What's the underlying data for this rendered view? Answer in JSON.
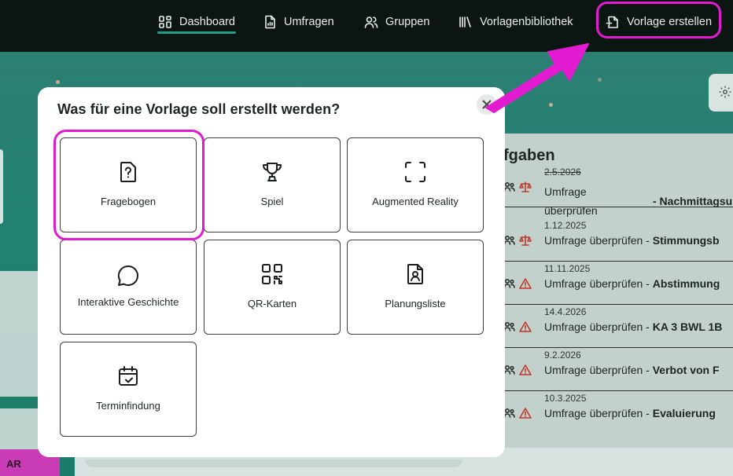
{
  "nav": {
    "items": [
      {
        "label": "Dashboard",
        "icon": "dashboard-icon",
        "active": true
      },
      {
        "label": "Umfragen",
        "icon": "survey-icon"
      },
      {
        "label": "Gruppen",
        "icon": "groups-icon"
      },
      {
        "label": "Vorlagenbibliothek",
        "icon": "library-icon"
      },
      {
        "label": "Vorlage erstellen",
        "icon": "file-plus-icon"
      }
    ],
    "accent": "#1f9e8a",
    "highlight_color": "#e21bd1"
  },
  "background": {
    "tasks_title": "fgaben",
    "ar_tag": "AR",
    "tasks": [
      {
        "date": "2.5.2026",
        "text": "Umfrage überprüfen",
        "bold": "- Nachmittagsu"
      },
      {
        "date": "1.12.2025",
        "text": "Umfrage überprüfen - ",
        "bold": "Stimmungsb"
      },
      {
        "date": "11.11.2025",
        "text": "Umfrage überprüfen - ",
        "bold": "Abstimmung"
      },
      {
        "date": "14.4.2026",
        "text": "Umfrage überprüfen - ",
        "bold": "KA 3 BWL 1B"
      },
      {
        "date": "9.2.2026",
        "text": "Umfrage überprüfen - ",
        "bold": "Verbot von F"
      },
      {
        "date": "10.3.2025",
        "text": "Umfrage überprüfen - ",
        "bold": "Evaluierung"
      }
    ]
  },
  "modal": {
    "title": "Was für eine Vorlage soll erstellt werden?",
    "tiles": [
      {
        "label": "Fragebogen",
        "icon": "question-file-icon",
        "highlighted": true
      },
      {
        "label": "Spiel",
        "icon": "trophy-icon"
      },
      {
        "label": "Augmented Reality",
        "icon": "scan-frame-icon"
      },
      {
        "label": "Interaktive Geschichte",
        "icon": "speech-bubble-icon"
      },
      {
        "label": "QR-Karten",
        "icon": "qr-code-icon"
      },
      {
        "label": "Planungsliste",
        "icon": "user-file-icon"
      },
      {
        "label": "Terminfindung",
        "icon": "calendar-check-icon"
      }
    ]
  }
}
